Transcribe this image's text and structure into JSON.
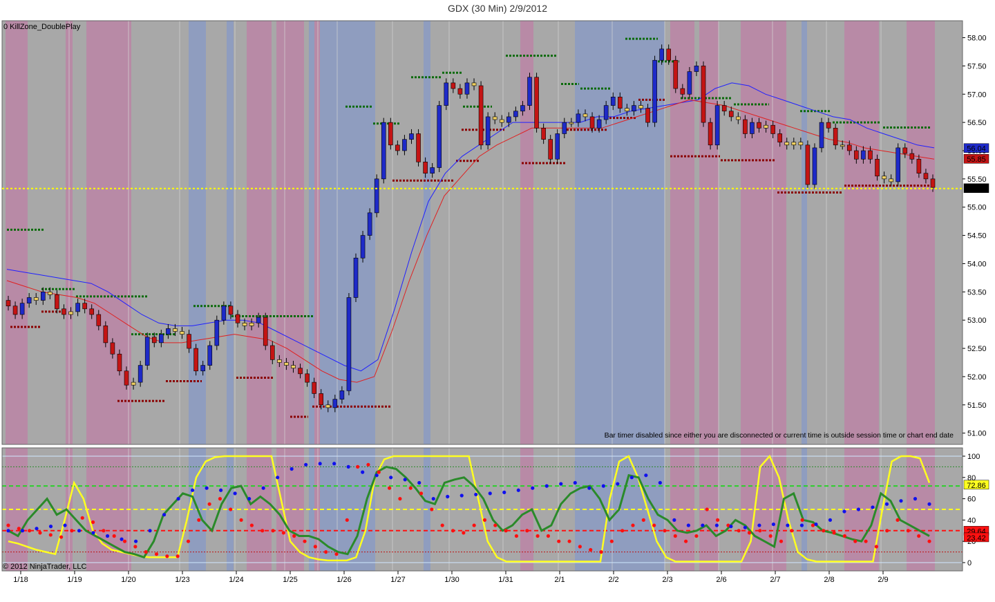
{
  "title": "GDX (30 Min)  2/9/2012",
  "indicator_label": "0 KillZone_DoublePlay",
  "copyright": "© 2012 NinjaTrader, LLC",
  "bar_timer_note": "Bar timer disabled since either you are disconnected or current time is outside session time or chart end date",
  "colors": {
    "background": "#a8a8a8",
    "pink_zone": "#b88aa6",
    "blue_zone": "#8f9dbf",
    "up_candle": "#1e2ac8",
    "down_candle": "#c41414",
    "neutral_candle": "#f0d060",
    "last_price_line": "#ffff00",
    "upper_ma": "#2020ff",
    "lower_ma": "#e02020",
    "resistance_dots": "#0a6a0a",
    "support_dots": "#8a0000",
    "osc_yellow": "#ffff20",
    "osc_green": "#2a8a2a",
    "osc_red": "#ff1010",
    "osc_blue": "#1010ee"
  },
  "chart_data": [
    {
      "type": "candlestick",
      "title": "GDX (30 Min)  2/9/2012",
      "x_ticks": [
        "1/18",
        "1/19",
        "1/20",
        "1/23",
        "1/24",
        "1/25",
        "1/26",
        "1/27",
        "1/30",
        "1/31",
        "2/1",
        "2/2",
        "2/3",
        "2/6",
        "2/7",
        "2/8",
        "2/9"
      ],
      "y_ticks": [
        "58.00",
        "57.50",
        "57.00",
        "56.50",
        "56.00",
        "55.50",
        "55.00",
        "54.50",
        "54.00",
        "53.50",
        "53.00",
        "52.50",
        "52.00",
        "51.50",
        "51.00"
      ],
      "ylim": [
        50.8,
        58.3
      ],
      "last_price": 55.33,
      "price_labels": [
        {
          "text": "56.04",
          "value": 56.04,
          "color": "#1e2ac8"
        },
        {
          "text": "55.85",
          "value": 55.85,
          "color": "#c41414"
        },
        {
          "text": "55.33",
          "value": 55.33,
          "color": "#000000"
        }
      ],
      "series": [
        {
          "name": "price",
          "closes": [
            53.25,
            53.1,
            53.3,
            53.4,
            53.35,
            53.5,
            53.45,
            53.2,
            53.1,
            53.15,
            53.3,
            53.2,
            53.1,
            52.9,
            52.6,
            52.4,
            52.1,
            51.85,
            51.9,
            52.2,
            52.7,
            52.6,
            52.75,
            52.85,
            52.8,
            52.75,
            52.5,
            52.1,
            52.2,
            52.55,
            53.0,
            53.25,
            53.1,
            52.95,
            52.9,
            52.95,
            53.05,
            52.55,
            52.3,
            52.25,
            52.2,
            52.15,
            52.05,
            51.9,
            51.7,
            51.5,
            51.45,
            51.6,
            51.75,
            53.4,
            54.1,
            54.5,
            54.9,
            55.5,
            56.5,
            56.1,
            56.0,
            56.2,
            56.3,
            55.8,
            55.6,
            55.7,
            56.8,
            57.2,
            57.1,
            57.0,
            57.2,
            57.15,
            56.1,
            56.6,
            56.55,
            56.5,
            56.6,
            56.7,
            56.8,
            57.3,
            56.4,
            56.2,
            55.85,
            56.3,
            56.5,
            56.5,
            56.65,
            56.6,
            56.4,
            56.55,
            56.8,
            56.95,
            56.75,
            56.7,
            56.8,
            56.75,
            56.5,
            57.6,
            57.8,
            57.6,
            57.1,
            57.0,
            57.4,
            57.5,
            56.5,
            56.1,
            56.8,
            56.7,
            56.6,
            56.55,
            56.3,
            56.5,
            56.4,
            56.45,
            56.3,
            56.15,
            56.1,
            56.15,
            56.1,
            55.4,
            56.05,
            56.5,
            56.4,
            56.1,
            56.1,
            56.0,
            55.85,
            56.0,
            55.85,
            55.55,
            55.5,
            55.45,
            56.05,
            55.95,
            55.85,
            55.6,
            55.5,
            55.35
          ]
        },
        {
          "name": "blue_envelope",
          "values": [
            53.9,
            53.85,
            53.8,
            53.75,
            53.7,
            53.65,
            53.5,
            53.3,
            53.1,
            52.95,
            52.9,
            52.9,
            52.95,
            53.0,
            53.0,
            52.95,
            52.8,
            52.65,
            52.5,
            52.35,
            52.2,
            52.1,
            52.3,
            53.2,
            54.2,
            55.1,
            55.6,
            55.9,
            56.1,
            56.3,
            56.5,
            56.5,
            56.5,
            56.5,
            56.5,
            56.6,
            56.6,
            56.7,
            56.75,
            56.8,
            56.85,
            56.9,
            57.1,
            57.2,
            57.15,
            57.0,
            56.9,
            56.8,
            56.7,
            56.6,
            56.55,
            56.4,
            56.3,
            56.2,
            56.1,
            56.05
          ]
        },
        {
          "name": "red_envelope",
          "values": [
            53.7,
            53.6,
            53.5,
            53.45,
            53.4,
            53.3,
            53.1,
            52.9,
            52.7,
            52.6,
            52.6,
            52.65,
            52.7,
            52.75,
            52.7,
            52.65,
            52.5,
            52.3,
            52.1,
            51.95,
            51.9,
            52.0,
            52.8,
            53.7,
            54.5,
            55.2,
            55.55,
            55.9,
            56.1,
            56.25,
            56.4,
            56.4,
            56.4,
            56.4,
            56.4,
            56.5,
            56.6,
            56.7,
            56.8,
            56.9,
            56.85,
            56.8,
            56.7,
            56.6,
            56.5,
            56.4,
            56.3,
            56.2,
            56.15,
            56.05,
            56.0,
            55.95,
            55.9,
            55.85
          ]
        }
      ]
    },
    {
      "type": "line",
      "y_ticks": [
        "100",
        "80",
        "60",
        "40",
        "20",
        "0"
      ],
      "ylim": [
        0,
        100
      ],
      "price_labels": [
        {
          "text": "72.86",
          "value": 72.86,
          "color": "#ffff20"
        },
        {
          "text": "29.64",
          "value": 29.64,
          "color": "#ff1010"
        },
        {
          "text": "23.42",
          "value": 23.42,
          "color": "#ff1010"
        }
      ],
      "reference_levels": [
        50,
        30,
        70,
        90,
        10
      ],
      "series": [
        {
          "name": "yellow",
          "values": [
            20,
            18,
            15,
            12,
            10,
            8,
            40,
            75,
            60,
            30,
            18,
            12,
            10,
            8,
            6,
            5,
            5,
            5,
            5,
            40,
            80,
            95,
            99,
            100,
            100,
            100,
            100,
            100,
            100,
            60,
            20,
            10,
            5,
            3,
            2,
            2,
            2,
            5,
            30,
            80,
            97,
            100,
            100,
            100,
            100,
            100,
            100,
            100,
            100,
            100,
            60,
            20,
            5,
            1,
            1,
            1,
            1,
            1,
            1,
            1,
            1,
            1,
            1,
            1,
            60,
            95,
            100,
            80,
            50,
            20,
            5,
            1,
            1,
            1,
            1,
            1,
            1,
            1,
            1,
            20,
            90,
            100,
            80,
            40,
            10,
            3,
            1,
            1,
            1,
            1,
            1,
            1,
            1,
            50,
            95,
            100,
            100,
            98,
            75
          ]
        },
        {
          "name": "green",
          "values": [
            30,
            25,
            40,
            50,
            60,
            45,
            50,
            40,
            30,
            25,
            20,
            15,
            10,
            8,
            5,
            20,
            45,
            55,
            65,
            62,
            40,
            30,
            55,
            70,
            72,
            55,
            62,
            55,
            45,
            30,
            25,
            25,
            22,
            15,
            10,
            8,
            25,
            60,
            85,
            90,
            88,
            80,
            70,
            58,
            55,
            75,
            78,
            80,
            72,
            60,
            40,
            30,
            35,
            45,
            50,
            30,
            35,
            55,
            65,
            70,
            72,
            60,
            40,
            50,
            82,
            80,
            60,
            45,
            40,
            30,
            28,
            30,
            35,
            25,
            30,
            40,
            35,
            25,
            20,
            15,
            60,
            65,
            40,
            38,
            30,
            28,
            25,
            22,
            20,
            35,
            65,
            58,
            40,
            35,
            30,
            25
          ]
        },
        {
          "name": "red",
          "values": [
            35,
            32,
            30,
            28,
            26,
            24,
            30,
            42,
            38,
            30,
            25,
            20,
            15,
            10,
            8,
            6,
            6,
            20,
            40,
            55,
            60,
            50,
            40,
            35,
            30,
            30,
            28,
            25,
            20,
            15,
            10,
            8,
            40,
            90,
            92,
            85,
            70,
            60,
            70,
            65,
            50,
            35,
            30,
            28,
            35,
            40,
            35,
            30,
            25,
            30,
            25,
            25,
            20,
            20,
            15,
            12,
            10,
            20,
            30,
            35,
            40,
            35,
            30,
            25,
            20,
            25,
            50,
            40,
            35,
            30,
            28,
            30,
            25,
            20,
            30,
            40,
            35,
            30,
            28,
            25,
            20,
            20,
            15,
            30,
            40,
            30,
            25,
            20
          ]
        },
        {
          "name": "blue",
          "values": [
            30,
            30,
            32,
            34,
            35,
            30,
            28,
            25,
            22,
            20,
            30,
            45,
            60,
            68,
            70,
            68,
            65,
            60,
            70,
            80,
            88,
            92,
            93,
            93,
            90,
            85,
            82,
            80,
            78,
            75,
            60,
            62,
            63,
            64,
            65,
            66,
            68,
            70,
            72,
            74,
            75,
            70,
            72,
            74,
            80,
            82,
            75,
            40,
            35,
            35,
            35,
            34,
            33,
            35,
            36,
            35,
            35,
            36,
            40,
            48,
            50,
            52,
            55,
            58,
            60,
            55
          ]
        }
      ]
    }
  ]
}
